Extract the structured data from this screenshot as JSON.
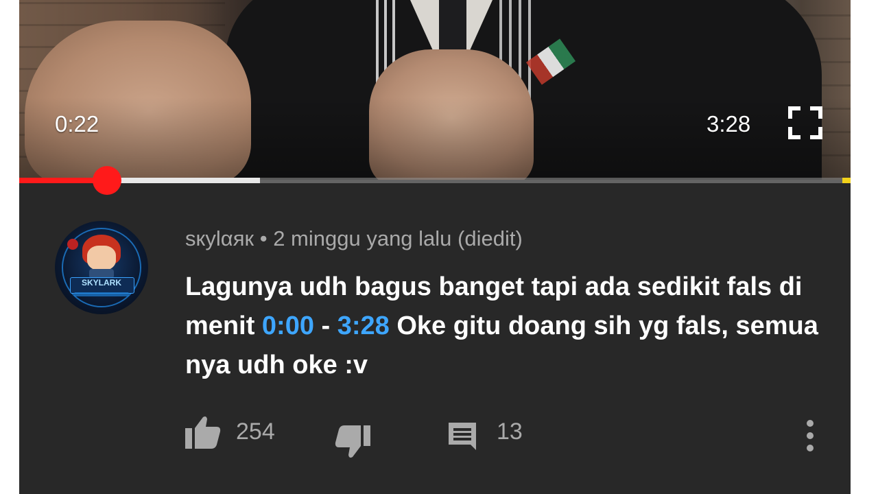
{
  "player": {
    "current_time": "0:22",
    "duration": "3:28",
    "played_fraction": 0.106,
    "buffered_fraction": 0.29,
    "progress_color": "#ff1a1a",
    "fullscreen_icon": "fullscreen-icon"
  },
  "comment": {
    "author": "sкуlαяк",
    "separator": "•",
    "time_ago": "2 minggu yang lalu (diedit)",
    "text_part1": "Lagunya udh bagus banget tapi ada sedikit fals di menit ",
    "timestamp_start": "0:00",
    "text_dash": " - ",
    "timestamp_end": "3:28",
    "text_part2": " Oke gitu doang sih yg fals, semua nya udh oke :v",
    "timestamp_color": "#3ea6ff",
    "avatar": {
      "banner_text": "SKYLARK"
    }
  },
  "actions": {
    "like_icon": "thumbs-up-icon",
    "like_count": "254",
    "dislike_icon": "thumbs-down-icon",
    "reply_icon": "comment-icon",
    "reply_count": "13",
    "more_icon": "more-vertical-icon"
  }
}
